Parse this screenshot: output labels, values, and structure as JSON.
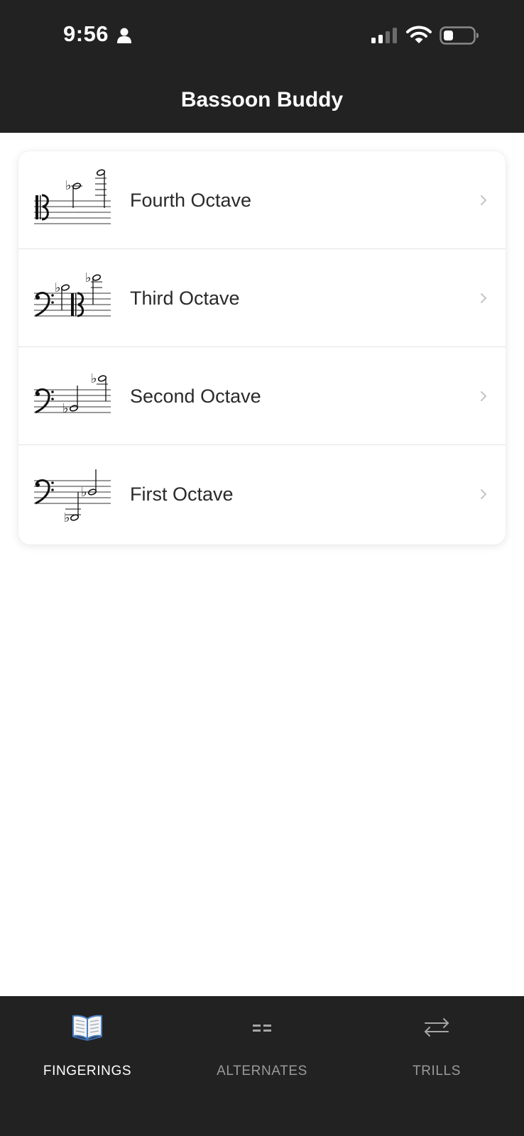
{
  "status_bar": {
    "time": "9:56"
  },
  "nav": {
    "title": "Bassoon Buddy"
  },
  "octaves": [
    {
      "label": "Fourth Octave"
    },
    {
      "label": "Third Octave"
    },
    {
      "label": "Second Octave"
    },
    {
      "label": "First Octave"
    }
  ],
  "tabs": [
    {
      "label": "FINGERINGS",
      "icon": "open-book-icon",
      "active": true
    },
    {
      "label": "ALTERNATES",
      "icon": "alternates-icon",
      "active": false
    },
    {
      "label": "TRILLS",
      "icon": "trill-arrows-icon",
      "active": false
    }
  ],
  "colors": {
    "bar_background": "#222222",
    "active_tab_label": "#ffffff",
    "inactive_tab_label": "#9a9a9a",
    "list_text": "#2a2a2a"
  }
}
